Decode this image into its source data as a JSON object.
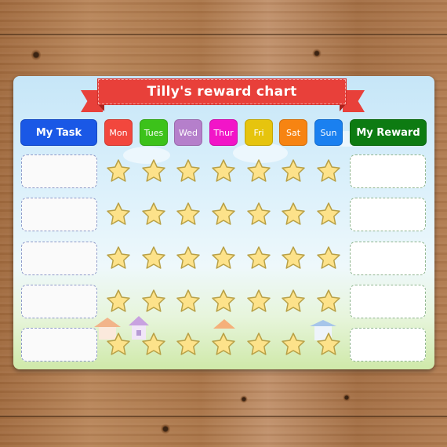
{
  "chart": {
    "title": "Tilly's reward chart",
    "task_header": "My Task",
    "reward_header": "My Reward",
    "days": [
      {
        "label": "Mon",
        "color": "#f2473d"
      },
      {
        "label": "Tues",
        "color": "#3cc21a"
      },
      {
        "label": "Wed",
        "color": "#b57fcb"
      },
      {
        "label": "Thur",
        "color": "#f215c8"
      },
      {
        "label": "Fri",
        "color": "#e6c40e"
      },
      {
        "label": "Sat",
        "color": "#f78412"
      },
      {
        "label": "Sun",
        "color": "#1a80f0"
      }
    ],
    "colors": {
      "ribbon": "#e8403a",
      "task_header": "#1a58e6",
      "reward_header": "#0d7b12",
      "star_fill": "#fde28a",
      "star_stroke": "#b8a046"
    },
    "rows": 5,
    "stars_per_row": 7,
    "task_entries": [
      "",
      "",
      "",
      "",
      ""
    ],
    "reward_entries": [
      "",
      "",
      "",
      "",
      ""
    ]
  }
}
